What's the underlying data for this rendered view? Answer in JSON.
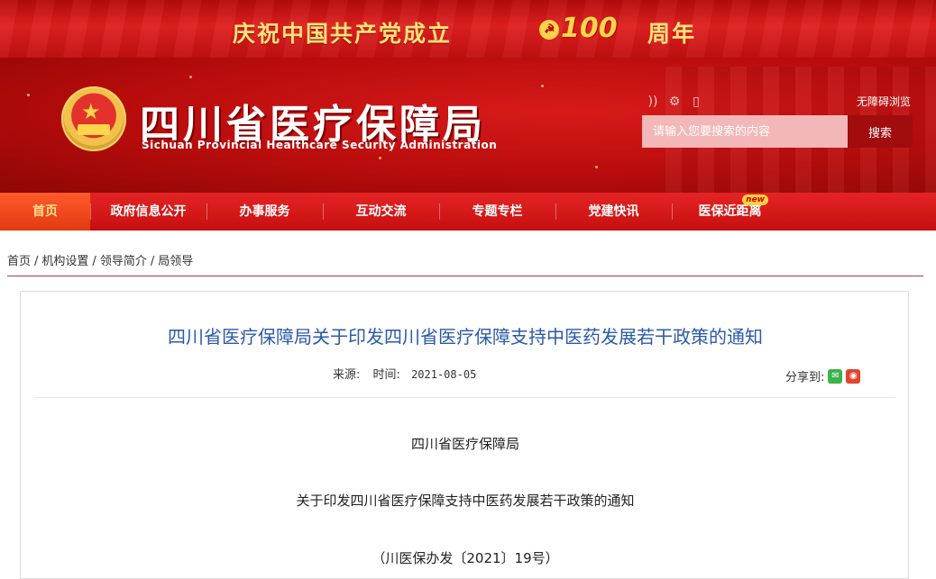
{
  "banner": {
    "text": "庆祝中国共产党成立",
    "number": "100",
    "tail": "周年"
  },
  "header": {
    "title": "四川省医疗保障局",
    "subtitle": "Sichuan Provincial Healthcare Security Administration",
    "accessibility_link": "无障碍浏览",
    "icons": [
      "rss-icon",
      "settings-icon",
      "mobile-icon"
    ],
    "search": {
      "placeholder": "请输入您要搜索的内容",
      "button": "搜索"
    }
  },
  "nav": {
    "items": [
      {
        "label": "首页",
        "active": true
      },
      {
        "label": "政府信息公开"
      },
      {
        "label": "办事服务"
      },
      {
        "label": "互动交流"
      },
      {
        "label": "专题专栏"
      },
      {
        "label": "党建快讯"
      },
      {
        "label": "医保近距离",
        "badge": "new"
      }
    ]
  },
  "breadcrumb": [
    "首页",
    "机构设置",
    "领导简介",
    "局领导"
  ],
  "article": {
    "title": "四川省医疗保障局关于印发四川省医疗保障支持中医药发展若干政策的通知",
    "source_label": "来源:",
    "time_label": "时间:",
    "date": "2021-08-05",
    "share_label": "分享到:",
    "paragraphs": [
      "四川省医疗保障局",
      "关于印发四川省医疗保障支持中医药发展若干政策的通知",
      "（川医保办发〔2021〕19号）"
    ]
  },
  "colors": {
    "primary_red": "#c60f0f",
    "title_blue": "#2a5aa8",
    "banner_gold": "#ffe37a"
  }
}
